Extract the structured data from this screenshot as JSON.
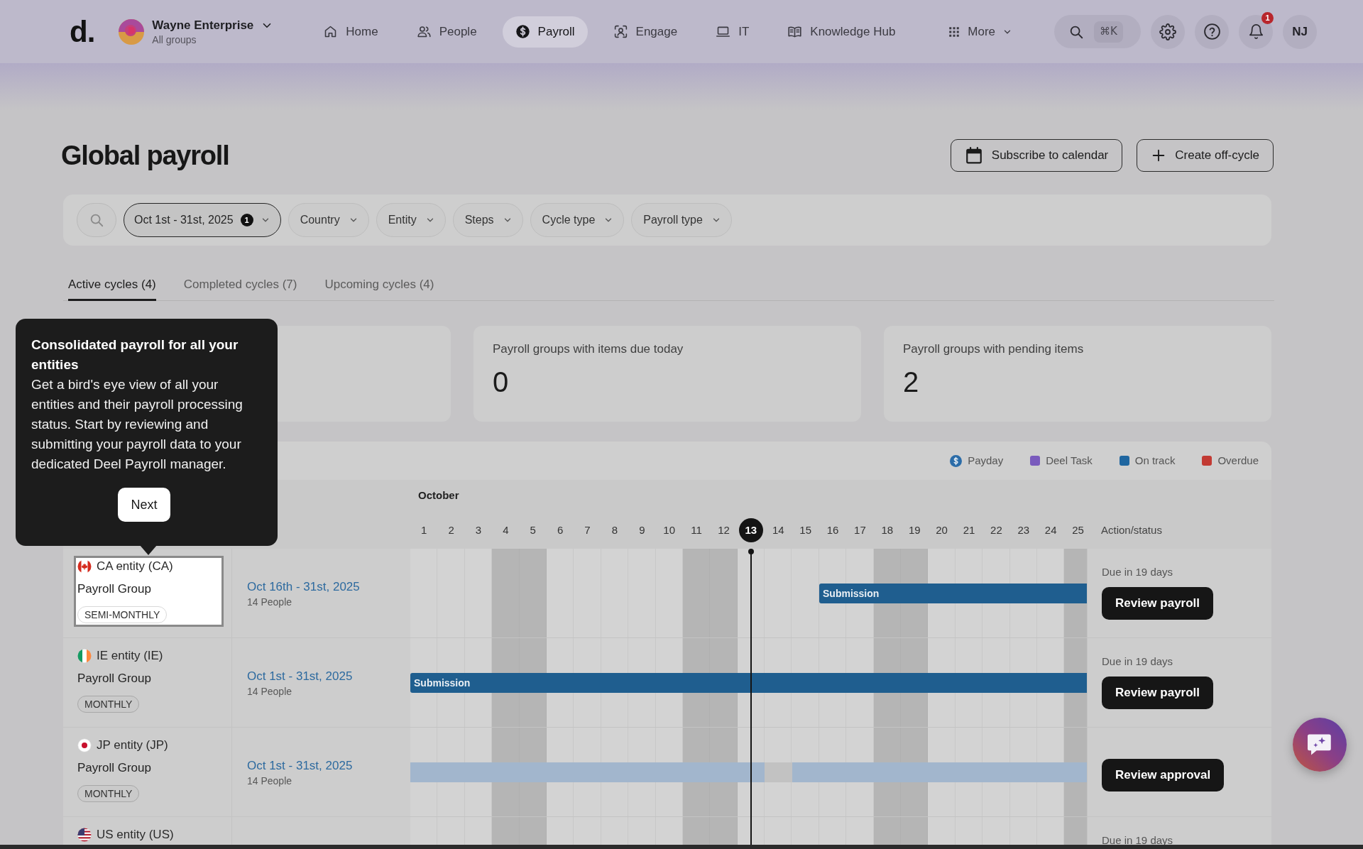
{
  "nav": {
    "logo": "d.",
    "org": {
      "name": "Wayne Enterprise",
      "subtitle": "All groups"
    },
    "items": [
      {
        "label": "Home",
        "selected": false
      },
      {
        "label": "People",
        "selected": false
      },
      {
        "label": "Payroll",
        "selected": true
      },
      {
        "label": "Engage",
        "selected": false
      },
      {
        "label": "IT",
        "selected": false
      },
      {
        "label": "Knowledge Hub",
        "selected": false
      }
    ],
    "more_label": "More",
    "search_shortcut": "⌘K",
    "notification_count": "1",
    "avatar_initials": "NJ"
  },
  "header": {
    "title": "Global payroll",
    "actions": [
      "Subscribe to calendar",
      "Create off-cycle"
    ]
  },
  "filters": [
    {
      "label": "Oct 1st - 31st, 2025",
      "count": "1",
      "active": true
    },
    {
      "label": "Country",
      "active": false
    },
    {
      "label": "Entity",
      "active": false
    },
    {
      "label": "Steps",
      "active": false
    },
    {
      "label": "Cycle type",
      "active": false
    },
    {
      "label": "Payroll type",
      "active": false
    }
  ],
  "tabs": [
    {
      "label": "Active cycles (4)",
      "selected": true
    },
    {
      "label": "Completed cycles (7)",
      "selected": false
    },
    {
      "label": "Upcoming cycles (4)",
      "selected": false
    }
  ],
  "summary_cards": [
    {
      "label": "Payroll groups with items due today",
      "value": "0"
    },
    {
      "label": "Payroll groups with pending items",
      "value": "2"
    }
  ],
  "legend": [
    {
      "label": "Payday",
      "kind": "payday",
      "color": "#2b6ca8"
    },
    {
      "label": "Deel Task",
      "kind": "swatch",
      "color": "#7a5bbd"
    },
    {
      "label": "On track",
      "kind": "swatch",
      "color": "#1f66a0"
    },
    {
      "label": "Overdue",
      "kind": "swatch",
      "color": "#c23a33"
    }
  ],
  "timeline": {
    "month": "October",
    "days": [
      {
        "label": "1",
        "weekend": false,
        "today": false
      },
      {
        "label": "2",
        "weekend": false,
        "today": false
      },
      {
        "label": "3",
        "weekend": false,
        "today": false
      },
      {
        "label": "4",
        "weekend": true,
        "today": false
      },
      {
        "label": "5",
        "weekend": true,
        "today": false
      },
      {
        "label": "6",
        "weekend": false,
        "today": false
      },
      {
        "label": "7",
        "weekend": false,
        "today": false
      },
      {
        "label": "8",
        "weekend": false,
        "today": false
      },
      {
        "label": "9",
        "weekend": false,
        "today": false
      },
      {
        "label": "10",
        "weekend": false,
        "today": false
      },
      {
        "label": "11",
        "weekend": true,
        "today": false
      },
      {
        "label": "12",
        "weekend": true,
        "today": false
      },
      {
        "label": "13",
        "weekend": false,
        "today": true
      },
      {
        "label": "14",
        "weekend": false,
        "today": false
      },
      {
        "label": "15",
        "weekend": false,
        "today": false
      },
      {
        "label": "16",
        "weekend": false,
        "today": false
      },
      {
        "label": "17",
        "weekend": false,
        "today": false
      },
      {
        "label": "18",
        "weekend": true,
        "today": false
      },
      {
        "label": "19",
        "weekend": true,
        "today": false
      },
      {
        "label": "20",
        "weekend": false,
        "today": false
      },
      {
        "label": "21",
        "weekend": false,
        "today": false
      },
      {
        "label": "22",
        "weekend": false,
        "today": false
      },
      {
        "label": "23",
        "weekend": false,
        "today": false
      },
      {
        "label": "24",
        "weekend": false,
        "today": false
      },
      {
        "label": "25",
        "weekend": true,
        "today": false
      }
    ],
    "action_header": "Action/status"
  },
  "rows": [
    {
      "entity": "CA entity (CA)",
      "group": "Payroll Group",
      "frequency": "SEMI-MONTHLY",
      "highlighted": true,
      "period": "Oct 16th - 31st, 2025",
      "people": "14 People",
      "bar_label": "Submission",
      "days": [
        {
          "kind": "none"
        },
        {
          "kind": "none"
        },
        {
          "kind": "none"
        },
        {
          "kind": "none"
        },
        {
          "kind": "none"
        },
        {
          "kind": "none"
        },
        {
          "kind": "none"
        },
        {
          "kind": "none"
        },
        {
          "kind": "none"
        },
        {
          "kind": "none"
        },
        {
          "kind": "none"
        },
        {
          "kind": "none"
        },
        {
          "kind": "none"
        },
        {
          "kind": "none"
        },
        {
          "kind": "none"
        },
        {
          "kind": "on_track"
        },
        {
          "kind": "on_track"
        },
        {
          "kind": "on_track"
        },
        {
          "kind": "on_track"
        },
        {
          "kind": "on_track"
        },
        {
          "kind": "on_track"
        },
        {
          "kind": "on_track"
        },
        {
          "kind": "on_track"
        },
        {
          "kind": "on_track"
        },
        {
          "kind": "on_track"
        }
      ],
      "due": "Due in 19 days",
      "action": "Review payroll"
    },
    {
      "entity": "IE entity (IE)",
      "group": "Payroll Group",
      "frequency": "MONTHLY",
      "highlighted": false,
      "period": "Oct 1st - 31st, 2025",
      "people": "14 People",
      "bar_label": "Submission",
      "days": [
        {
          "kind": "on_track"
        },
        {
          "kind": "on_track"
        },
        {
          "kind": "on_track"
        },
        {
          "kind": "on_track"
        },
        {
          "kind": "on_track"
        },
        {
          "kind": "on_track"
        },
        {
          "kind": "on_track"
        },
        {
          "kind": "on_track"
        },
        {
          "kind": "on_track"
        },
        {
          "kind": "on_track"
        },
        {
          "kind": "on_track"
        },
        {
          "kind": "on_track"
        },
        {
          "kind": "on_track"
        },
        {
          "kind": "on_track"
        },
        {
          "kind": "on_track"
        },
        {
          "kind": "on_track"
        },
        {
          "kind": "on_track"
        },
        {
          "kind": "on_track"
        },
        {
          "kind": "on_track"
        },
        {
          "kind": "on_track"
        },
        {
          "kind": "on_track"
        },
        {
          "kind": "on_track"
        },
        {
          "kind": "on_track"
        },
        {
          "kind": "on_track"
        },
        {
          "kind": "on_track"
        }
      ],
      "due": "Due in 19 days",
      "action": "Review payroll"
    },
    {
      "entity": "JP entity (JP)",
      "group": "Payroll Group",
      "frequency": "MONTHLY",
      "highlighted": false,
      "period": "Oct 1st - 31st, 2025",
      "people": "14 People",
      "days": [
        {
          "kind": "pending"
        },
        {
          "kind": "pending"
        },
        {
          "kind": "pending"
        },
        {
          "kind": "pending"
        },
        {
          "kind": "pending"
        },
        {
          "kind": "pending"
        },
        {
          "kind": "pending"
        },
        {
          "kind": "pending"
        },
        {
          "kind": "pending"
        },
        {
          "kind": "pending"
        },
        {
          "kind": "pending"
        },
        {
          "kind": "pending"
        },
        {
          "kind": "pending"
        },
        {
          "kind": "gap"
        },
        {
          "kind": "pending"
        },
        {
          "kind": "pending"
        },
        {
          "kind": "pending"
        },
        {
          "kind": "pending"
        },
        {
          "kind": "pending"
        },
        {
          "kind": "pending"
        },
        {
          "kind": "pending"
        },
        {
          "kind": "pending"
        },
        {
          "kind": "pending"
        },
        {
          "kind": "pending"
        },
        {
          "kind": "pending"
        }
      ],
      "action": "Review approval"
    },
    {
      "entity": "US entity (US)",
      "highlighted": false,
      "due": "Due in 19 days"
    }
  ],
  "tooltip": {
    "title": "Consolidated payroll for all your entities",
    "body": "Get a bird's eye view of all your entities and their payroll processing status. Start by reviewing and submitting your payroll data to your dedicated Deel Payroll manager.",
    "button": "Next"
  }
}
